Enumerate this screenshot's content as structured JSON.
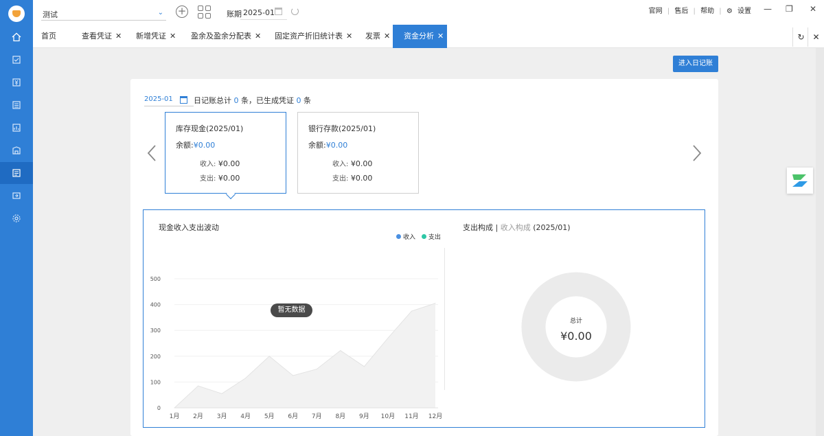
{
  "topbar": {
    "account": "测试",
    "period_label": "账期",
    "period_value": "2025-01",
    "links": [
      "官网",
      "售后",
      "帮助",
      "设置"
    ]
  },
  "tabs": [
    {
      "label": "首页",
      "closable": false
    },
    {
      "label": "查看凭证",
      "closable": true
    },
    {
      "label": "新增凭证",
      "closable": true
    },
    {
      "label": "盈余及盈余分配表",
      "closable": true
    },
    {
      "label": "固定资产折旧统计表",
      "closable": true
    },
    {
      "label": "发票",
      "closable": true
    },
    {
      "label": "资金分析",
      "closable": true,
      "active": true
    }
  ],
  "sidebar": {
    "icons": [
      "home-icon",
      "voucher-icon",
      "yuan-icon",
      "ledger-icon",
      "report-icon",
      "asset-icon",
      "cash-icon",
      "invoice-icon",
      "settings-icon"
    ],
    "active_index": 6
  },
  "main": {
    "journal_button": "进入日记账",
    "filter_date": "2025-01",
    "summary": {
      "prefix": "日记账总计",
      "journal_count": "0",
      "mid": "条，已生成凭证",
      "voucher_count": "0",
      "suffix": "条"
    },
    "cards": [
      {
        "title": "库存现金(2025/01)",
        "balance_label": "余额:",
        "balance": "¥0.00",
        "income_label": "收入:",
        "income": "¥0.00",
        "expense_label": "支出:",
        "expense": "¥0.00"
      },
      {
        "title": "银行存款(2025/01)",
        "balance_label": "余额:",
        "balance": "¥0.00",
        "income_label": "收入:",
        "income": "¥0.00",
        "expense_label": "支出:",
        "expense": "¥0.00"
      }
    ],
    "line_chart": {
      "title": "现金收入支出波动",
      "legend": [
        {
          "name": "收入",
          "color": "#4a90e2"
        },
        {
          "name": "支出",
          "color": "#2ec7a6"
        }
      ],
      "no_data": "暂无数据"
    },
    "pie": {
      "title_main": "支出构成",
      "title_sep": " | ",
      "title_alt": "收入构成",
      "title_period": " (2025/01)",
      "center_label": "总计",
      "center_value": "¥0.00"
    }
  },
  "chart_data": {
    "type": "area",
    "categories": [
      "1月",
      "2月",
      "3月",
      "4月",
      "5月",
      "6月",
      "7月",
      "8月",
      "9月",
      "10月",
      "11月",
      "12月"
    ],
    "values": [
      0,
      85,
      55,
      115,
      200,
      125,
      150,
      222,
      160,
      270,
      375,
      405
    ],
    "ylim": [
      0,
      500
    ],
    "yticks": [
      0,
      100,
      200,
      300,
      400,
      500
    ],
    "grid": true
  }
}
